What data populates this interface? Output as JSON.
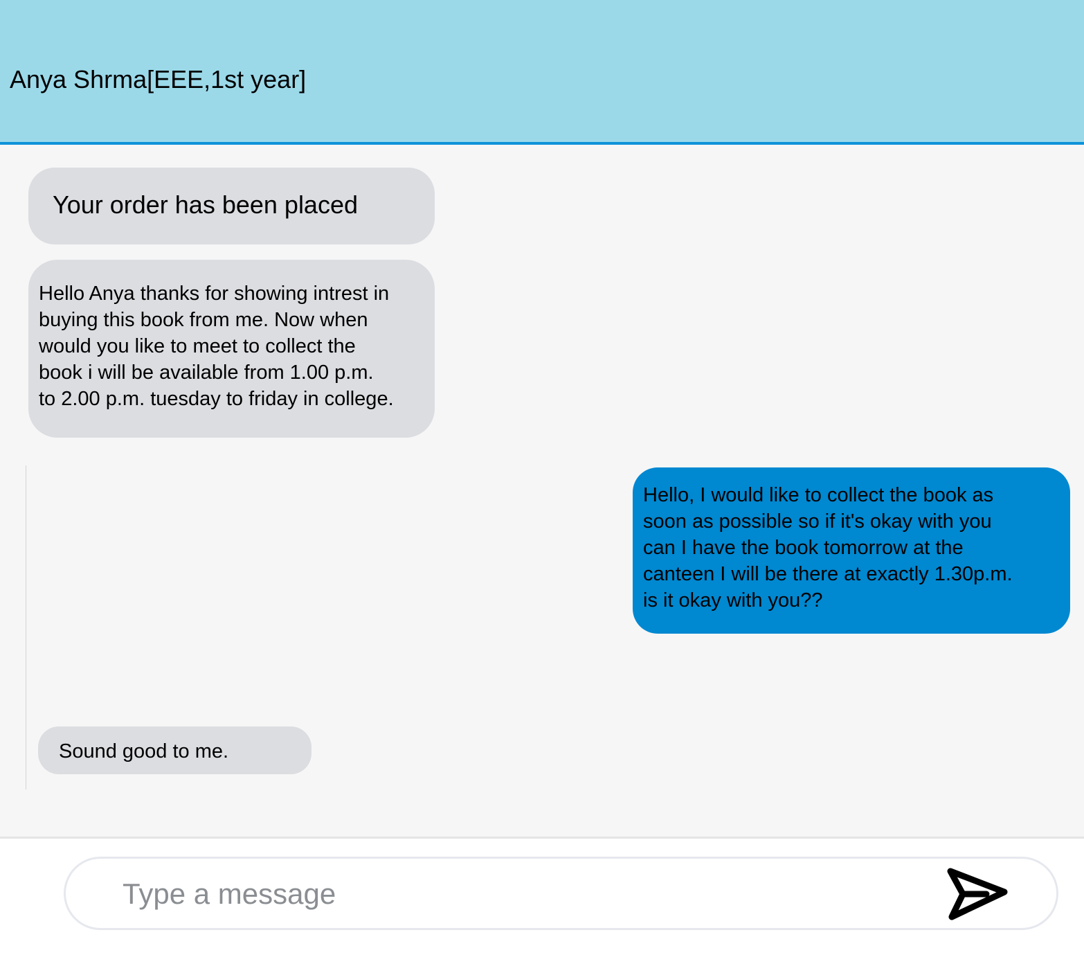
{
  "header": {
    "title": "Anya Shrma[EEE,1st year]"
  },
  "messages": [
    {
      "direction": "incoming",
      "text": "Your order has been placed"
    },
    {
      "direction": "incoming",
      "text": "Hello Anya thanks for showing intrest in\nbuying this book from me. Now when\nwould you like to meet to collect the\nbook i will be available from 1.00 p.m.\nto 2.00 p.m. tuesday to friday in college."
    },
    {
      "direction": "outgoing",
      "text": "Hello, I would like to collect the book as\nsoon as possible so if it's okay with you\ncan I have the book tomorrow at the\ncanteen I will be there at exactly 1.30p.m.\nis it  okay with you??"
    },
    {
      "direction": "incoming",
      "text": "Sound good to me."
    }
  ],
  "composer": {
    "placeholder": "Type a message",
    "value": "",
    "send_icon": "send-icon"
  },
  "colors": {
    "header_bg": "#9bd9e9",
    "header_border": "#0d93d8",
    "incoming_bubble": "#dcdde1",
    "outgoing_bubble": "#0088d1",
    "chat_bg": "#f6f6f6"
  }
}
